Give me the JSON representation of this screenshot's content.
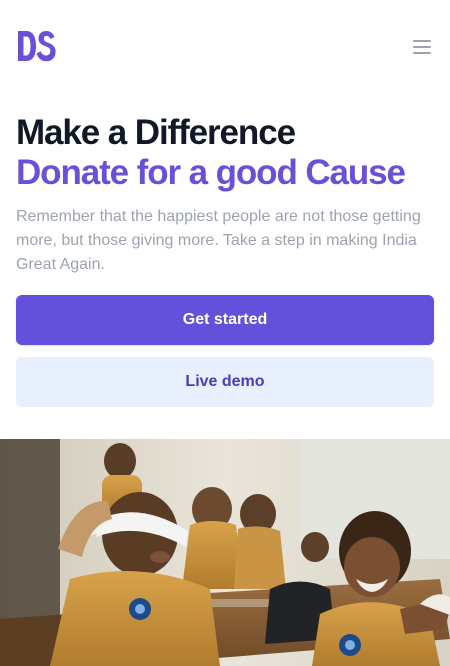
{
  "header": {
    "logo_text": "DS",
    "menu_icon": "hamburger-menu-icon"
  },
  "hero": {
    "title_line1": "Make a Difference",
    "title_line2": "Donate for a good Cause",
    "description": "Remember that the happiest people are not those getting more, but those giving more. Take a step in making India Great Again.",
    "primary_cta": "Get started",
    "secondary_cta": "Live demo"
  },
  "colors": {
    "brand": "#6b4fd8",
    "primary_button": "#6451db",
    "secondary_button_bg": "#e8f0fd",
    "heading": "#111827",
    "muted_text": "#9ca3af"
  }
}
